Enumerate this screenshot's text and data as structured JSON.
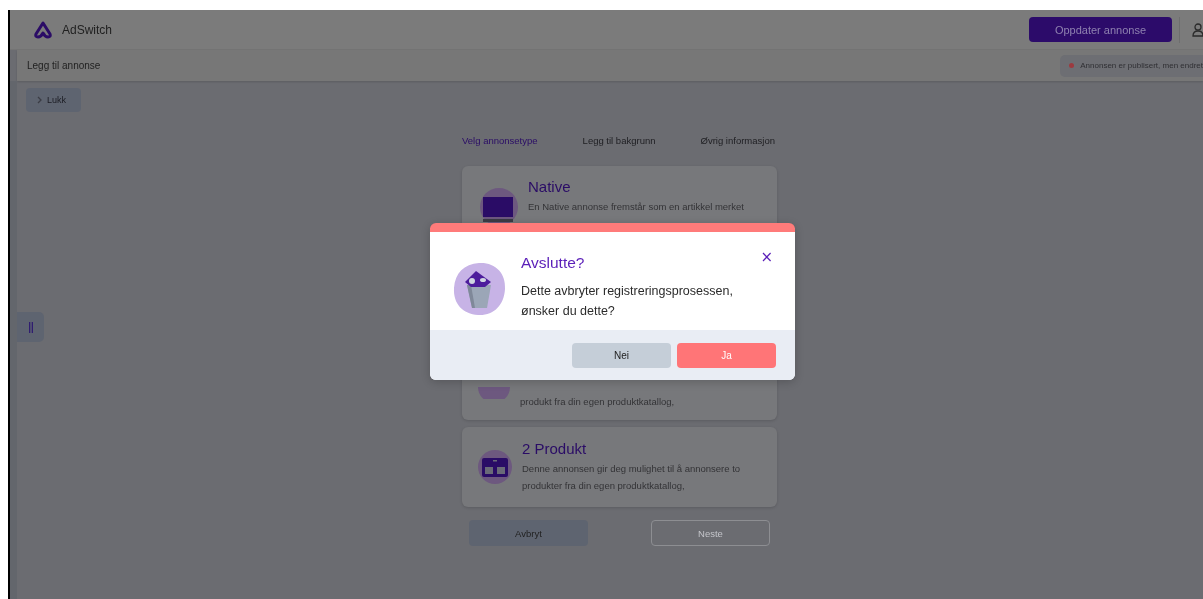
{
  "header": {
    "brand": "AdSwitch",
    "update_button": "Oppdater annonse"
  },
  "subheader": {
    "title": "Legg til annonse",
    "status": "Annonsen er publisert, men endret"
  },
  "close_button": "Lukk",
  "steps": [
    {
      "label": "Velg annonsetype",
      "selected": true
    },
    {
      "label": "Legg til bakgrunn",
      "selected": false
    },
    {
      "label": "Øvrig informasjon",
      "selected": false
    }
  ],
  "ad_types": [
    {
      "kind": "native",
      "title": "Native",
      "description": "En Native annonse fremstår som en artikkel merket"
    },
    {
      "kind": "partial",
      "description": "produkt fra din egen produktkatallog,"
    },
    {
      "kind": "product",
      "title": "2 Produkt",
      "description": "Denne annonsen gir deg mulighet til å annonsere to produkter fra din egen produktkatallog,"
    }
  ],
  "actions": [
    {
      "label": "Avbryt",
      "disabled": false
    },
    {
      "label": "Neste",
      "disabled": true
    }
  ],
  "dialog": {
    "title": "Avslutte?",
    "message": "Dette avbryter registreringsprosessen, ønsker du dette?",
    "close": "×",
    "buttons": [
      {
        "label": "Nei",
        "kind": "secondary"
      },
      {
        "label": "Ja",
        "kind": "danger"
      }
    ]
  }
}
